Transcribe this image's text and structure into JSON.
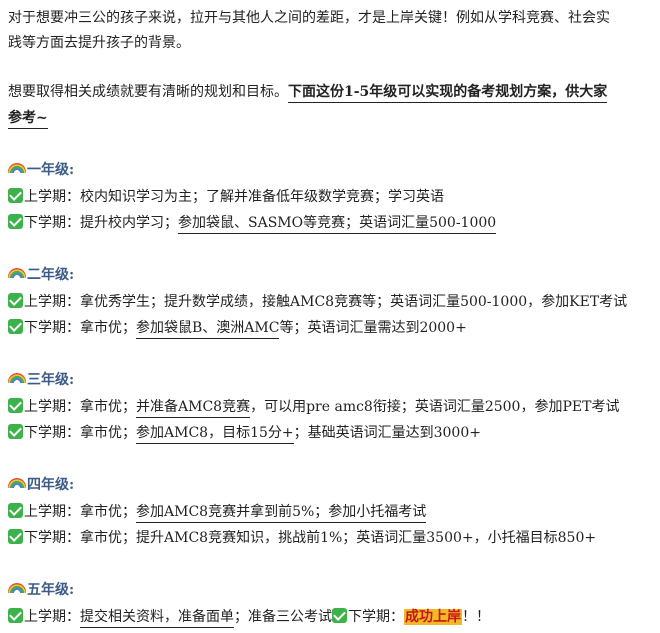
{
  "intro": {
    "line1": "对于想要冲三公的孩子来说，拉开与其他人之间的差距，才是上岸关键！例如从学科竞赛、社会实",
    "line2": "践等方面去提升孩子的背景。"
  },
  "plan_intro": {
    "text": "想要取得相关成绩就要有清晰的规划和目标。",
    "bold1": "下面这份1-5年级可以实现的备考规划方案，供大家",
    "bold2": "参考~"
  },
  "icons": {
    "heading": "rainbow-icon",
    "term": "check-icon"
  },
  "colors": {
    "grade_heading": "#3c5b86",
    "check": "#3cb34a",
    "highlight_bg": "#f3b826",
    "highlight_text": "#c4161c"
  },
  "grades": [
    {
      "title": "一年级:",
      "t1_label": "上学期：",
      "t1_text": "校内知识学习为主；了解并准备低年级数学竞赛；学习英语",
      "t2_label": "下学期：",
      "t2_text": "提升校内学习；",
      "t2_ul": "参加袋鼠、SASMO等竞赛；英语词汇量500-1000"
    },
    {
      "title": "二年级:",
      "t1_label": "上学期：",
      "t1_text": "拿优秀学生；提升数学成绩，接触AMC8竞赛等；英语词汇量500-1000，参加KET考试",
      "t2_label": "下学期：",
      "t2_pre": "拿市优；",
      "t2_ul": "参加袋鼠B、澳洲AMC",
      "t2_post": "等；英语词汇量需达到2000+"
    },
    {
      "title": "三年级:",
      "t1_label": "上学期：",
      "t1_pre": "拿市优；",
      "t1_ul": "并准备AMC8竞赛",
      "t1_post": "，可以用pre amc8衔接；英语词汇量2500，参加PET考试",
      "t2_label": "下学期：",
      "t2_pre": "拿市优；",
      "t2_ul": "参加AMC8，目标15分+",
      "t2_post": "；基础英语词汇量达到3000+"
    },
    {
      "title": "四年级:",
      "t1_label": "上学期：",
      "t1_pre": "拿市优；",
      "t1_ul": "参加AMC8竞赛并拿到前5%；参加小托福考试",
      "t2_label": "下学期：",
      "t2_text": "拿市优；提升AMC8竞赛知识，挑战前1%；英语词汇量3500+，小托福目标850+"
    },
    {
      "title": "五年级:",
      "t1_label": "上学期：",
      "t1_ul": "提交相关资料，准备面单",
      "t1_post": "；准备三公考试",
      "t2_label": "下学期：",
      "t2_highlight": "成功上岸",
      "t2_post": "！！"
    }
  ]
}
